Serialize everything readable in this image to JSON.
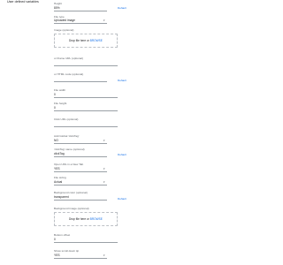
{
  "section": {
    "title": "User defined variables"
  },
  "fields": [
    {
      "id": "height",
      "label": "Height",
      "value": "80%",
      "link": "Default"
    },
    {
      "id": "file_type",
      "label": "File type",
      "value": "Uploaded image"
    },
    {
      "id": "image",
      "label": "Image (optional)",
      "drop_text": "Drop file here or",
      "browse": "BROWSE"
    },
    {
      "id": "iframe_url",
      "label": "or iframe URL (optional)",
      "value": ""
    },
    {
      "id": "html_code",
      "label": "or HTML code (optional)",
      "value": "",
      "link": "Default"
    },
    {
      "id": "file_width",
      "label": "File width",
      "value": "0"
    },
    {
      "id": "file_height",
      "label": "File height",
      "value": "0"
    },
    {
      "id": "click_url",
      "label": "Click URL (optional)",
      "value": ""
    },
    {
      "id": "add_click_tag",
      "label": "Add Global 'clickTag'",
      "value": "NO"
    },
    {
      "id": "click_tag_name",
      "label": "'clickTag' name (optional)",
      "value": "clickTag",
      "link": "Default"
    },
    {
      "id": "open_url",
      "label": "Open URL in a New Tab",
      "value": "YES"
    },
    {
      "id": "file_sizing",
      "label": "File sizing",
      "value": "Actual"
    },
    {
      "id": "bg_color",
      "label": "Background color (optional)",
      "value": "transparent",
      "link": "Default"
    },
    {
      "id": "bg_image",
      "label": "Background image (optional)",
      "drop_text": "Drop file here or",
      "browse": "BROWSE"
    },
    {
      "id": "bottom_offset",
      "label": "Bottom offset",
      "value": "0"
    },
    {
      "id": "show_scroll_down",
      "label": "Show scroll down tip",
      "value": "YES"
    }
  ]
}
